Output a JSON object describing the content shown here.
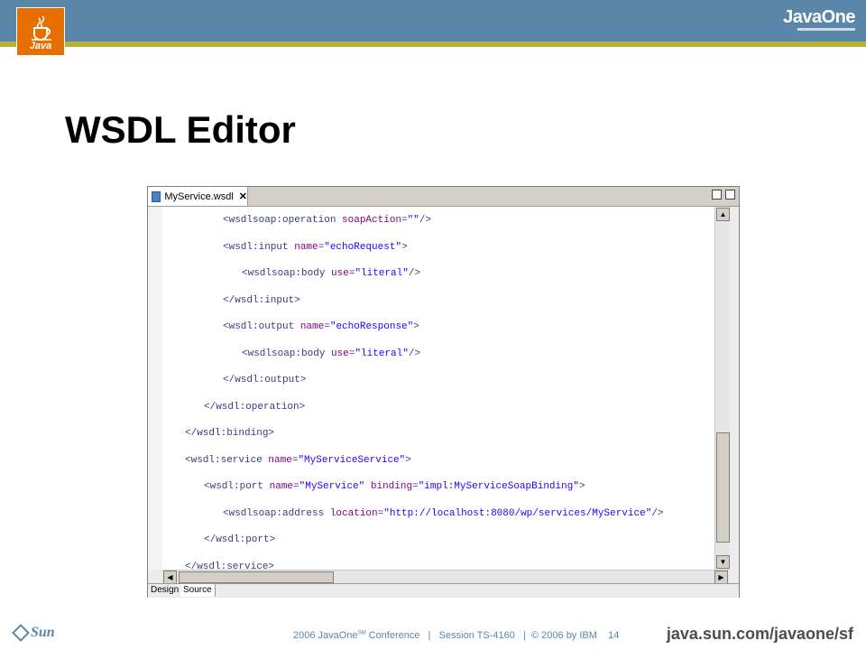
{
  "header": {
    "java_logo_text": "Java",
    "javaone_logo_text": "JavaOne"
  },
  "slide": {
    "title": "WSDL Editor"
  },
  "editor": {
    "tab_label": "MyService.wsdl",
    "bottom_tabs": [
      "Design",
      "Source"
    ],
    "code_lines": [
      {
        "indent": 3,
        "parts": [
          [
            "t",
            "<wsdlsoap:operation "
          ],
          [
            "a",
            "soapAction"
          ],
          [
            "t",
            "="
          ],
          [
            "v",
            "\"\""
          ],
          [
            "t",
            "/>"
          ]
        ]
      },
      {
        "indent": 3,
        "parts": [
          [
            "t",
            "<wsdl:input "
          ],
          [
            "a",
            "name"
          ],
          [
            "t",
            "="
          ],
          [
            "v",
            "\"echoRequest\""
          ],
          [
            "t",
            ">"
          ]
        ]
      },
      {
        "indent": 4,
        "parts": [
          [
            "t",
            "<wsdlsoap:body "
          ],
          [
            "a",
            "use"
          ],
          [
            "t",
            "="
          ],
          [
            "v",
            "\"literal\""
          ],
          [
            "t",
            "/>"
          ]
        ]
      },
      {
        "indent": 3,
        "parts": [
          [
            "t",
            "</wsdl:input>"
          ]
        ]
      },
      {
        "indent": 3,
        "parts": [
          [
            "t",
            "<wsdl:output "
          ],
          [
            "a",
            "name"
          ],
          [
            "t",
            "="
          ],
          [
            "v",
            "\"echoResponse\""
          ],
          [
            "t",
            ">"
          ]
        ]
      },
      {
        "indent": 4,
        "parts": [
          [
            "t",
            "<wsdlsoap:body "
          ],
          [
            "a",
            "use"
          ],
          [
            "t",
            "="
          ],
          [
            "v",
            "\"literal\""
          ],
          [
            "t",
            "/>"
          ]
        ]
      },
      {
        "indent": 3,
        "parts": [
          [
            "t",
            "</wsdl:output>"
          ]
        ]
      },
      {
        "indent": 2,
        "parts": [
          [
            "t",
            "</wsdl:operation>"
          ]
        ]
      },
      {
        "indent": 1,
        "parts": [
          [
            "t",
            "</wsdl:binding>"
          ]
        ]
      },
      {
        "indent": 1,
        "parts": [
          [
            "t",
            "<wsdl:service "
          ],
          [
            "a",
            "name"
          ],
          [
            "t",
            "="
          ],
          [
            "v",
            "\"MyServiceService\""
          ],
          [
            "t",
            ">"
          ]
        ]
      },
      {
        "indent": 2,
        "parts": [
          [
            "t",
            "<wsdl:port "
          ],
          [
            "a",
            "name"
          ],
          [
            "t",
            "="
          ],
          [
            "v",
            "\"MyService\""
          ],
          [
            "t",
            " "
          ],
          [
            "a",
            "binding"
          ],
          [
            "t",
            "="
          ],
          [
            "v",
            "\"impl:MyServiceSoapBinding\""
          ],
          [
            "t",
            ">"
          ]
        ]
      },
      {
        "indent": 3,
        "parts": [
          [
            "t",
            "<wsdlsoap:address "
          ],
          [
            "a",
            "location"
          ],
          [
            "t",
            "="
          ],
          [
            "v",
            "\"http://localhost:8080/wp/services/MyService\""
          ],
          [
            "t",
            "/>"
          ]
        ]
      },
      {
        "indent": 2,
        "parts": [
          [
            "t",
            "</wsdl:port>"
          ]
        ]
      },
      {
        "indent": 1,
        "parts": [
          [
            "t",
            "</wsdl:service>"
          ]
        ]
      }
    ]
  },
  "footer": {
    "conference_prefix": "2006 JavaOne",
    "conference_sup": "SM",
    "conference_suffix": " Conference   |   Session TS-4160   |  © 2006 by IBM    14",
    "sun_logo_text": "Sun",
    "url": "java.sun.com/javaone/sf"
  },
  "colors": {
    "header_blue": "#5a87a9",
    "header_stripe": "#b8b23a",
    "java_orange": "#e76f00",
    "xml_tag": "#3a3a86",
    "xml_attr": "#7f007f",
    "xml_value": "#2a00ff"
  },
  "icons": [
    "java-cup-icon",
    "file-icon",
    "close-icon",
    "minimize-icon",
    "maximize-icon",
    "scroll-up-icon",
    "scroll-down-icon",
    "scroll-left-icon",
    "scroll-right-icon",
    "sun-diamond-icon"
  ]
}
